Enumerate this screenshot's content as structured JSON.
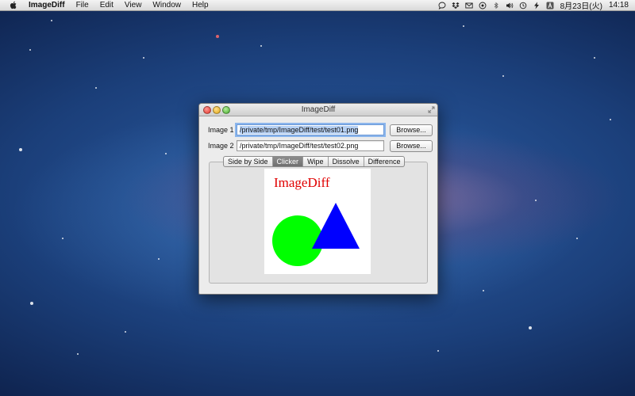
{
  "menubar": {
    "app_name": "ImageDiff",
    "items": [
      "File",
      "Edit",
      "View",
      "Window",
      "Help"
    ],
    "clock_date": "8月23日(火)",
    "clock_time": "14:18"
  },
  "window": {
    "title": "ImageDiff",
    "image1": {
      "label": "Image 1",
      "value": "/private/tmp/ImageDiff/test/test01.png",
      "browse_label": "Browse..."
    },
    "image2": {
      "label": "Image 2",
      "value": "/private/tmp/ImageDiff/test/test02.png",
      "browse_label": "Browse..."
    },
    "tabs": [
      {
        "label": "Side by Side",
        "selected": false
      },
      {
        "label": "Clicker",
        "selected": true
      },
      {
        "label": "Wipe",
        "selected": false
      },
      {
        "label": "Dissolve",
        "selected": false
      },
      {
        "label": "Difference",
        "selected": false
      }
    ],
    "preview": {
      "text": "ImageDiff",
      "text_color": "#e00000",
      "circle_color": "#00ff00",
      "triangle_color": "#0000ff"
    }
  },
  "icons": [
    "apple-icon",
    "chat-icon",
    "dropbox-icon",
    "mail-icon",
    "sync-icon",
    "bluetooth-icon",
    "volume-icon",
    "time-machine-icon",
    "battery-icon",
    "input-method-icon"
  ]
}
